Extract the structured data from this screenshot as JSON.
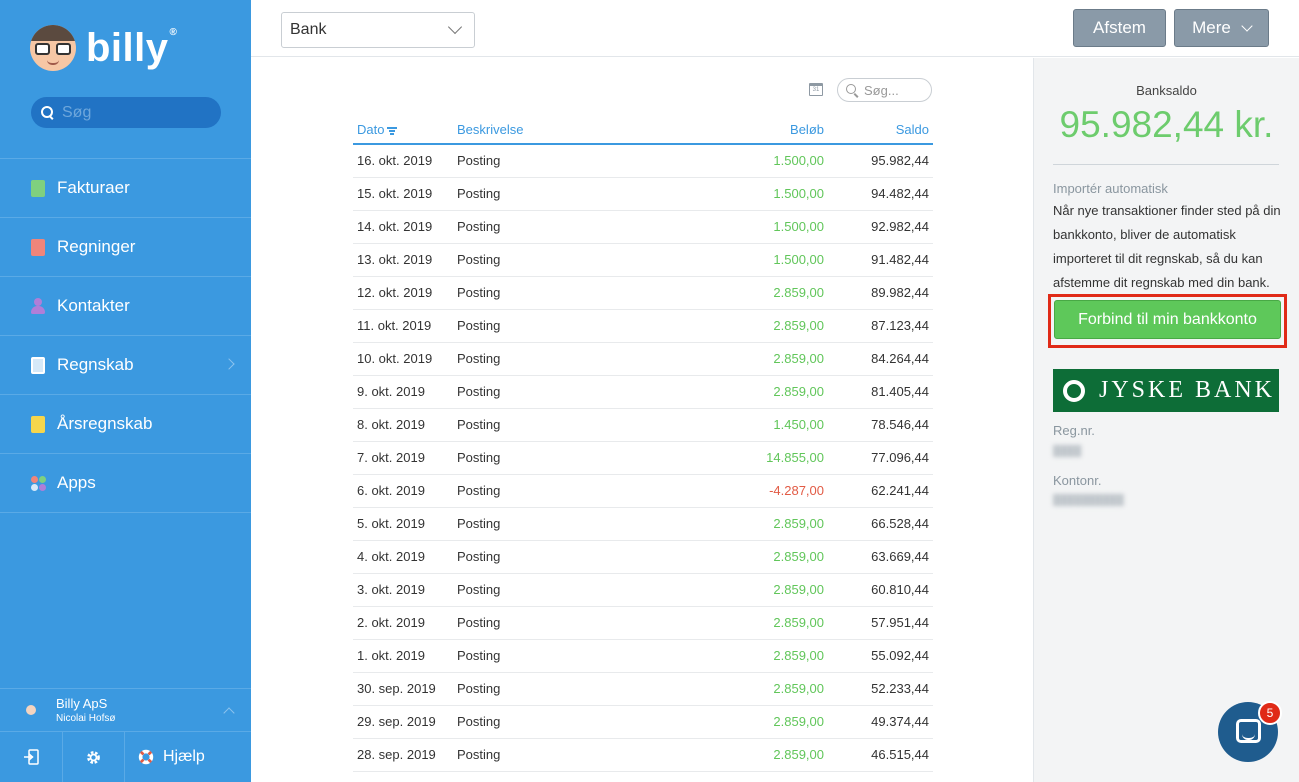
{
  "brand": {
    "name": "billy",
    "reg_mark": "®"
  },
  "sidebar": {
    "search_placeholder": "Søg",
    "items": [
      {
        "label": "Fakturaer",
        "icon": "invoice-icon"
      },
      {
        "label": "Regninger",
        "icon": "bill-icon"
      },
      {
        "label": "Kontakter",
        "icon": "contact-icon"
      },
      {
        "label": "Regnskab",
        "icon": "accounting-icon"
      },
      {
        "label": "Årsregnskab",
        "icon": "annual-report-icon"
      },
      {
        "label": "Apps",
        "icon": "apps-icon"
      }
    ],
    "company": {
      "name": "Billy ApS",
      "user": "Nicolai Hofsø"
    },
    "bottom": {
      "help_label": "Hjælp"
    }
  },
  "topbar": {
    "bank_select_value": "Bank",
    "afstem_label": "Afstem",
    "mere_label": "Mere"
  },
  "table": {
    "search_placeholder": "Søg...",
    "calendar_text": "31",
    "headers": {
      "date": "Dato",
      "description": "Beskrivelse",
      "amount": "Beløb",
      "balance": "Saldo"
    },
    "rows": [
      {
        "date": "16. okt. 2019",
        "description": "Posting",
        "amount": "1.500,00",
        "balance": "95.982,44"
      },
      {
        "date": "15. okt. 2019",
        "description": "Posting",
        "amount": "1.500,00",
        "balance": "94.482,44"
      },
      {
        "date": "14. okt. 2019",
        "description": "Posting",
        "amount": "1.500,00",
        "balance": "92.982,44"
      },
      {
        "date": "13. okt. 2019",
        "description": "Posting",
        "amount": "1.500,00",
        "balance": "91.482,44"
      },
      {
        "date": "12. okt. 2019",
        "description": "Posting",
        "amount": "2.859,00",
        "balance": "89.982,44"
      },
      {
        "date": "11. okt. 2019",
        "description": "Posting",
        "amount": "2.859,00",
        "balance": "87.123,44"
      },
      {
        "date": "10. okt. 2019",
        "description": "Posting",
        "amount": "2.859,00",
        "balance": "84.264,44"
      },
      {
        "date": "9. okt. 2019",
        "description": "Posting",
        "amount": "2.859,00",
        "balance": "81.405,44"
      },
      {
        "date": "8. okt. 2019",
        "description": "Posting",
        "amount": "1.450,00",
        "balance": "78.546,44"
      },
      {
        "date": "7. okt. 2019",
        "description": "Posting",
        "amount": "14.855,00",
        "balance": "77.096,44"
      },
      {
        "date": "6. okt. 2019",
        "description": "Posting",
        "amount": "-4.287,00",
        "balance": "62.241,44"
      },
      {
        "date": "5. okt. 2019",
        "description": "Posting",
        "amount": "2.859,00",
        "balance": "66.528,44"
      },
      {
        "date": "4. okt. 2019",
        "description": "Posting",
        "amount": "2.859,00",
        "balance": "63.669,44"
      },
      {
        "date": "3. okt. 2019",
        "description": "Posting",
        "amount": "2.859,00",
        "balance": "60.810,44"
      },
      {
        "date": "2. okt. 2019",
        "description": "Posting",
        "amount": "2.859,00",
        "balance": "57.951,44"
      },
      {
        "date": "1. okt. 2019",
        "description": "Posting",
        "amount": "2.859,00",
        "balance": "55.092,44"
      },
      {
        "date": "30. sep. 2019",
        "description": "Posting",
        "amount": "2.859,00",
        "balance": "52.233,44"
      },
      {
        "date": "29. sep. 2019",
        "description": "Posting",
        "amount": "2.859,00",
        "balance": "49.374,44"
      },
      {
        "date": "28. sep. 2019",
        "description": "Posting",
        "amount": "2.859,00",
        "balance": "46.515,44"
      }
    ]
  },
  "rightpanel": {
    "title": "Banksaldo",
    "balance": "95.982,44 kr.",
    "import_title": "Importér automatisk",
    "import_text": "Når nye transaktioner finder sted på din bankkonto, bliver de automatisk importeret til dit regnskab, så du kan afstemme dit regnskab med din bank.",
    "connect_button": "Forbind til min bankkonto",
    "bank_name": "JYSKE BANK",
    "reg_label": "Reg.nr.",
    "account_label": "Kontonr."
  },
  "chat": {
    "badge_count": "5"
  },
  "colors": {
    "sidebar_bg": "#3b99e0",
    "accent_blue": "#3b99e0",
    "positive_green": "#61c65a",
    "negative_red": "#e25b45",
    "balance_green": "#6dcc6d",
    "connect_green": "#5ec85a",
    "highlight_red": "#e02a17",
    "bank_green": "#0d6d37"
  }
}
